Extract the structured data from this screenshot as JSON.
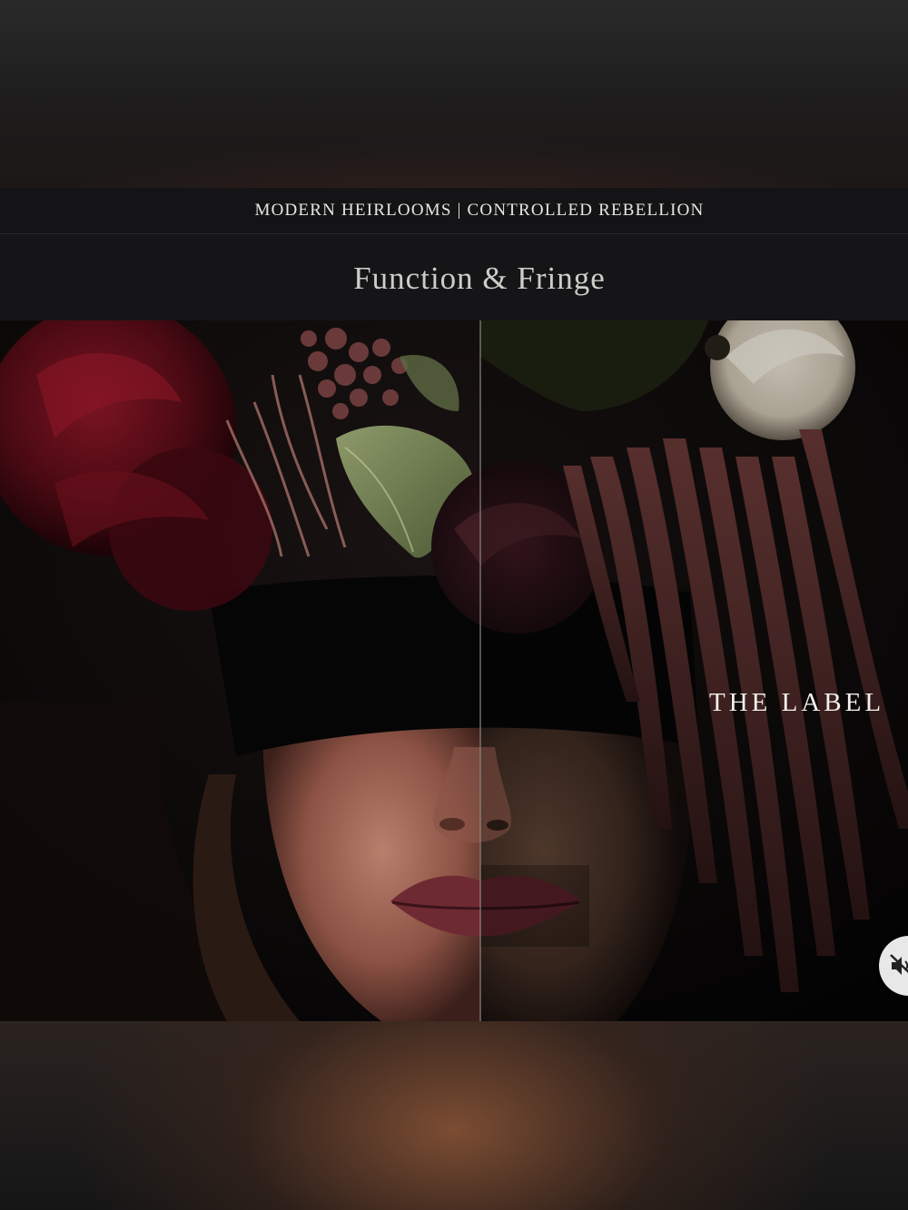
{
  "header": {
    "tagline": "MODERN HEIRLOOMS | CONTROLLED REBELLION",
    "title": "Function & Fringe"
  },
  "hero": {
    "overlay_text": "THE LABEL"
  },
  "controls": {
    "mute_icon": "speaker-muted-icon"
  },
  "colors": {
    "background": "#111111",
    "bar": "#141416",
    "title_text": "#cfccc8",
    "tagline_text": "#e9e6e2",
    "lips": "#6e2a33",
    "flower_red": "#5a0d17"
  }
}
